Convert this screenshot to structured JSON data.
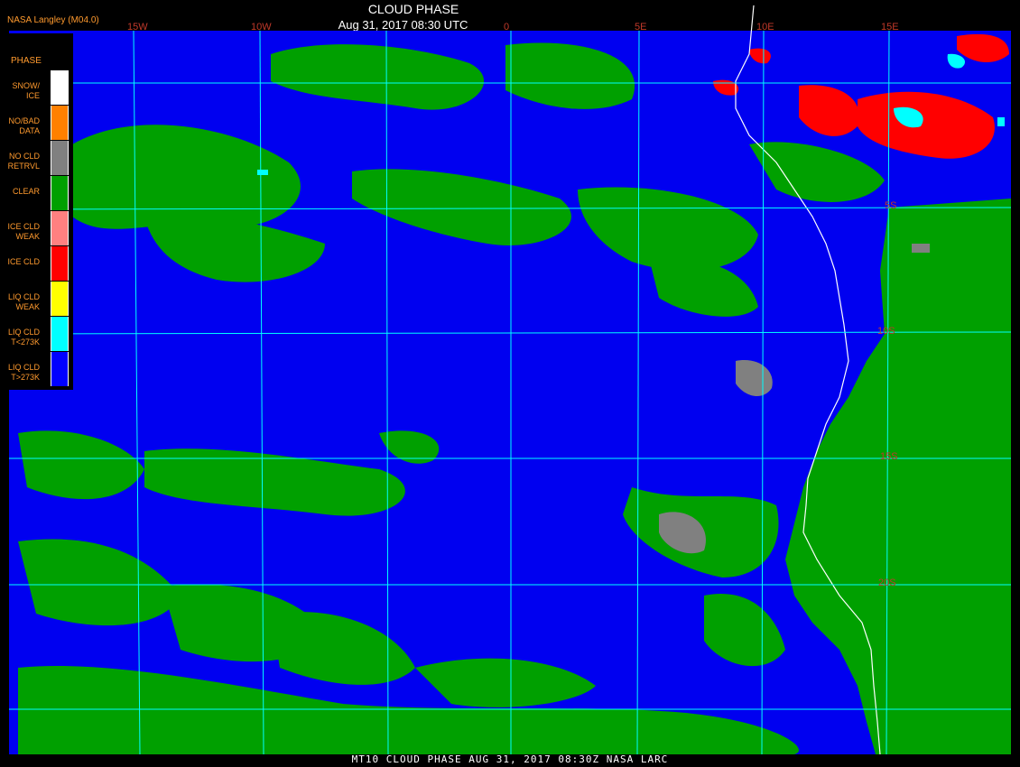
{
  "header": {
    "credit": "NASA Langley (M04.0)",
    "title": "CLOUD PHASE",
    "time": "Aug 31, 2017 08:30 UTC"
  },
  "footer": {
    "text": "MT10  CLOUD PHASE  AUG 31, 2017 08:30Z  NASA LARC"
  },
  "legend": {
    "title": "PHASE",
    "items": [
      {
        "label": "SNOW/ ICE",
        "color": "#ffffff"
      },
      {
        "label": "NO/BAD DATA",
        "color": "#ff8000"
      },
      {
        "label": "NO CLD RETRVL",
        "color": "#808080"
      },
      {
        "label": "CLEAR",
        "color": "#00a000"
      },
      {
        "label": "ICE CLD WEAK",
        "color": "#ff8080"
      },
      {
        "label": "ICE CLD",
        "color": "#ff0000"
      },
      {
        "label": "LIQ CLD WEAK",
        "color": "#ffff00"
      },
      {
        "label": "LIQ CLD T<273K",
        "color": "#00ffff"
      },
      {
        "label": "LIQ CLD T>273K",
        "color": "#0000ff"
      }
    ]
  },
  "grid": {
    "lon_labels": [
      "15W",
      "10W",
      "0",
      "5E",
      "10E",
      "15E"
    ],
    "lat_labels": [
      "5S",
      "10S",
      "15S",
      "20S"
    ],
    "color": "#00ffff"
  },
  "colors": {
    "ocean_liquid": "#0000ff",
    "clear": "#00a000",
    "ice": "#ff0000",
    "liquid_cold": "#00ffff",
    "no_retrieval": "#808080",
    "coastline": "#ffffff"
  }
}
